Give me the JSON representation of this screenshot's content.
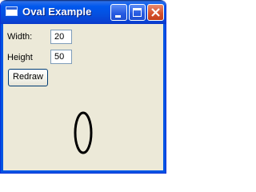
{
  "window": {
    "title": "Oval Example",
    "icon": "window-app-icon",
    "controls": {
      "minimize": "minimize-icon",
      "maximize": "maximize-icon",
      "close": "close-icon"
    }
  },
  "form": {
    "width_label": "Width:",
    "width_value": "20",
    "height_label": "Height",
    "height_value": "50",
    "redraw_label": "Redraw"
  },
  "oval": {
    "width": 20,
    "height": 50,
    "stroke_color": "#000000"
  },
  "colors": {
    "titlebar": "#0058ee",
    "close_button": "#d6532f",
    "client_background": "#ece9d8"
  }
}
